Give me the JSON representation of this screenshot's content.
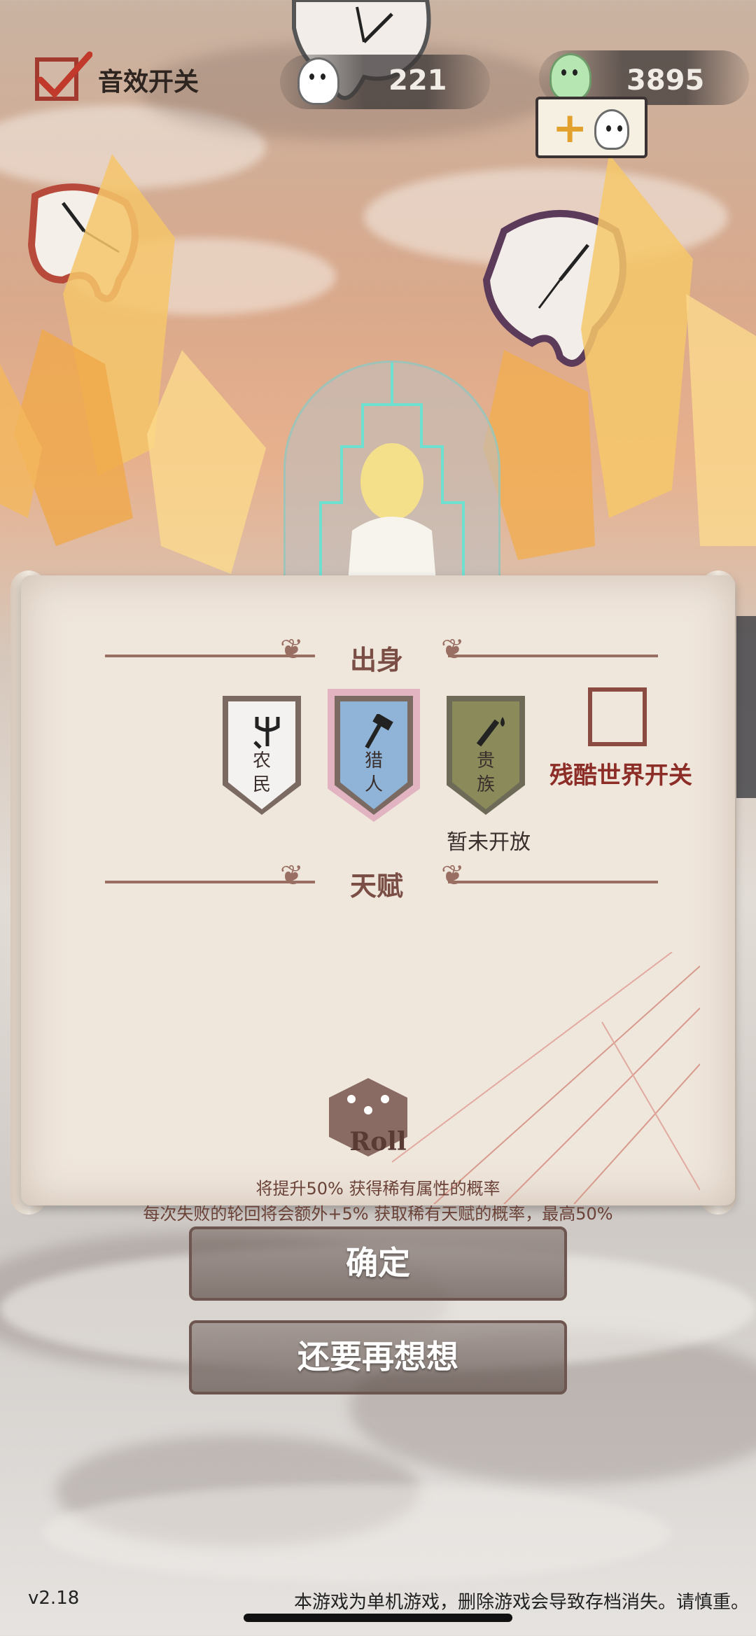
{
  "topbar": {
    "sound_label": "音效开关",
    "white_soul_count": "221",
    "green_soul_count": "3895"
  },
  "origin": {
    "title": "出身",
    "options": [
      {
        "label_line1": "农",
        "label_line2": "民"
      },
      {
        "label_line1": "猎",
        "label_line2": "人"
      },
      {
        "label_line1": "贵",
        "label_line2": "族"
      }
    ],
    "noble_status": "暂未开放",
    "cruel_world_label": "残酷世界开关"
  },
  "talent": {
    "title": "天赋"
  },
  "roll": {
    "label": "Roll",
    "desc_line1": "将提升50% 获得稀有属性的概率",
    "desc_line2": "每次失败的轮回将会额外+5% 获取稀有天赋的概率，最高50%"
  },
  "buttons": {
    "confirm": "确定",
    "reconsider": "还要再想想"
  },
  "footer": {
    "version": "v2.18",
    "note": "本游戏为单机游戏，删除游戏会导致存档消失。请慎重。"
  },
  "colors": {
    "accent_red": "#a33a2f",
    "title_brown": "#7a4e44",
    "hunter_blue": "#8fb4d8",
    "noble_olive": "#8a8a5a"
  }
}
